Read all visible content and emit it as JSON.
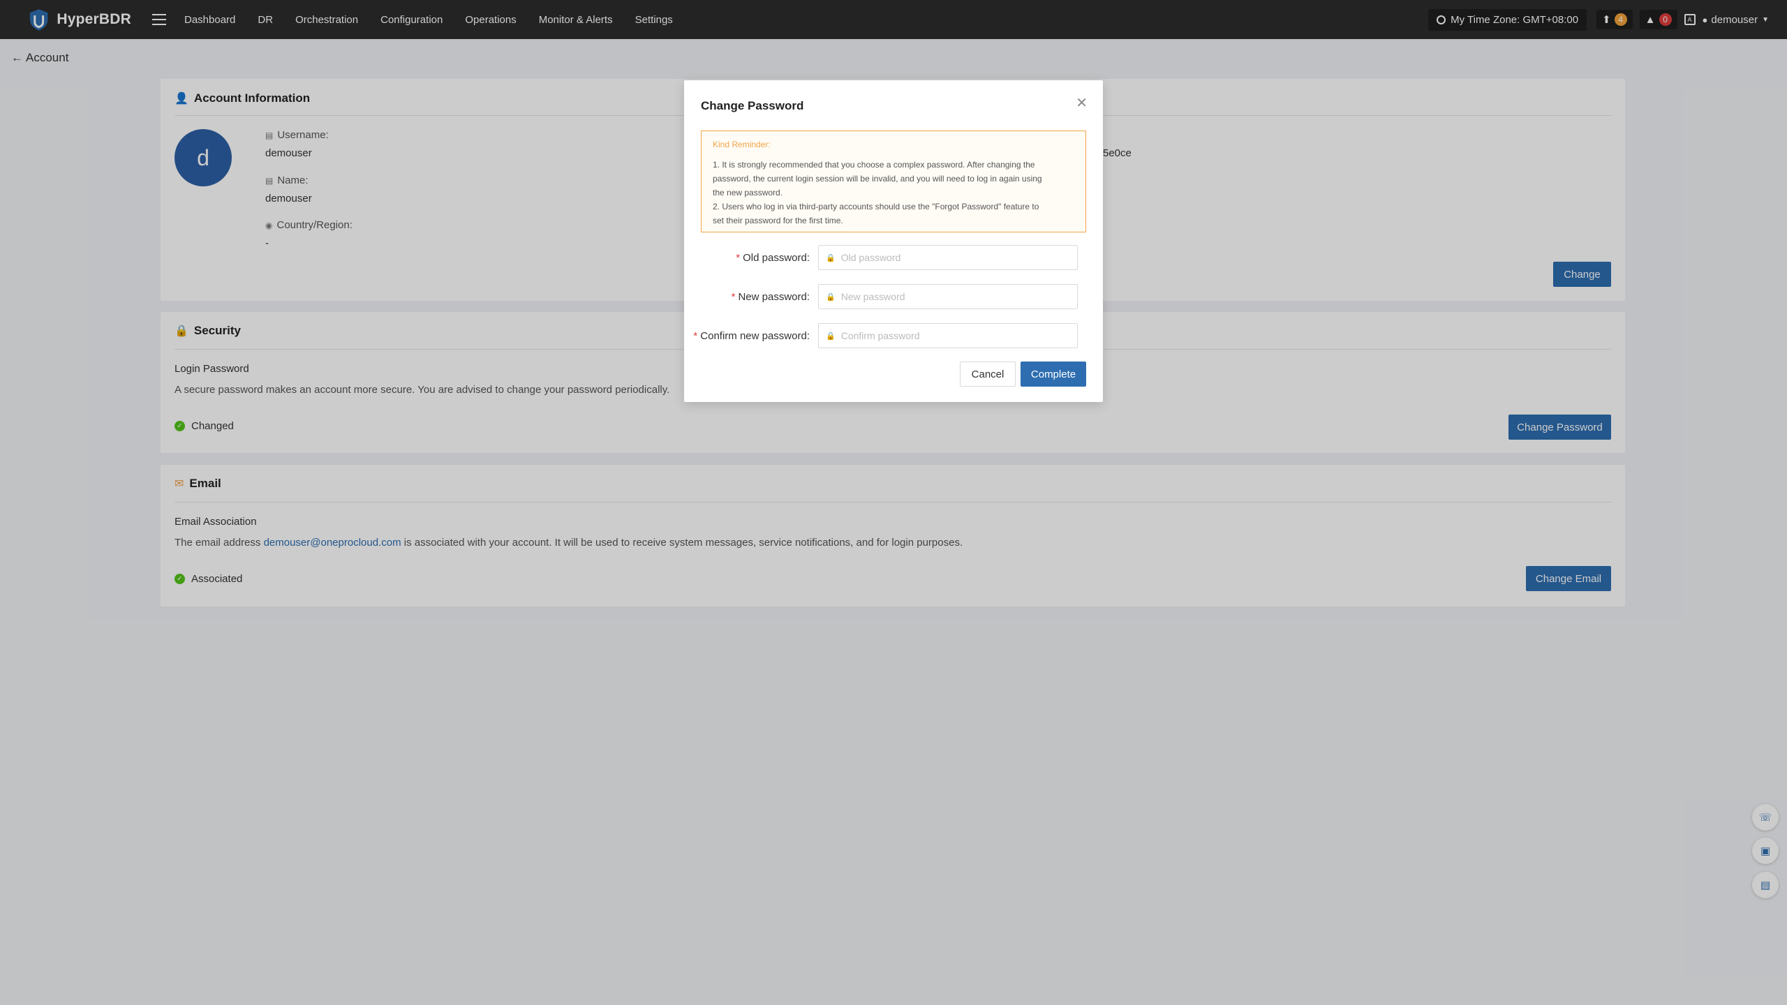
{
  "app": {
    "name": "HyperBDR"
  },
  "nav": {
    "items": [
      "Dashboard",
      "DR",
      "Orchestration",
      "Configuration",
      "Operations",
      "Monitor & Alerts",
      "Settings"
    ]
  },
  "topbar": {
    "timezone": "My Time Zone: GMT+08:00",
    "upgrade_count": "4",
    "alert_count": "0",
    "user": "demouser"
  },
  "page": {
    "back_label": "Account"
  },
  "account": {
    "title": "Account Information",
    "avatar_letter": "d",
    "username_label": "Username:",
    "username": "demouser",
    "name_label": "Name:",
    "name": "demouser",
    "country_label": "Country/Region:",
    "country": "-",
    "partial_text": "5e0ce",
    "change_button": "Change"
  },
  "security": {
    "title": "Security",
    "label": "Login Password",
    "description": "A secure password makes an account more secure. You are advised to change your password periodically.",
    "status": "Changed",
    "button": "Change Password"
  },
  "email": {
    "title": "Email",
    "label": "Email Association",
    "desc_prefix": "The email address ",
    "address": "demouser@oneprocloud.com",
    "desc_suffix": " is associated with your account. It will be used to receive system messages, service notifications, and for login purposes.",
    "status": "Associated",
    "button": "Change Email"
  },
  "modal": {
    "title": "Change Password",
    "reminder_title": "Kind Reminder:",
    "reminder_lines": [
      "1. It is strongly recommended that you choose a complex password. After changing the",
      "password, the current login session will be invalid, and you will need to log in again using",
      "the new password.",
      "2. Users who log in via third-party accounts should use the \"Forgot Password\" feature to",
      "set their password for the first time."
    ],
    "old_label": "Old password:",
    "old_placeholder": "Old password",
    "new_label": "New password:",
    "new_placeholder": "New password",
    "confirm_label": "Confirm new password:",
    "confirm_placeholder": "Confirm password",
    "cancel": "Cancel",
    "complete": "Complete"
  },
  "colors": {
    "primary": "#2d6db0",
    "success": "#52c41a",
    "warning": "#f0a347",
    "danger": "#e03c3c",
    "topbar": "#2c2c2c"
  }
}
